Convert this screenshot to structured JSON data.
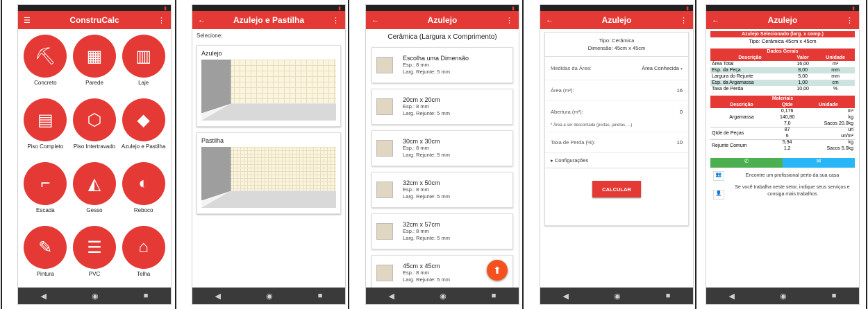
{
  "colors": {
    "primary": "#e53935",
    "fab": "#f4511e",
    "navbar": "#3a3a3a"
  },
  "home": {
    "title": "ConstruCalc",
    "items": [
      {
        "label": "Concreto",
        "icon": "wheelbarrow-icon",
        "glyph": "⛏"
      },
      {
        "label": "Parede",
        "icon": "brick-wall-icon",
        "glyph": "▦"
      },
      {
        "label": "Laje",
        "icon": "slab-icon",
        "glyph": "▥"
      },
      {
        "label": "Piso Completo",
        "icon": "floor-tiles-icon",
        "glyph": "▤"
      },
      {
        "label": "Piso Intertravado",
        "icon": "hexagon-icon",
        "glyph": "⬡"
      },
      {
        "label": "Azulejo e Pastilha",
        "icon": "diamond-tile-icon",
        "glyph": "◆"
      },
      {
        "label": "Escada",
        "icon": "stairs-icon",
        "glyph": "⌐"
      },
      {
        "label": "Gesso",
        "icon": "trowel-icon",
        "glyph": "◭"
      },
      {
        "label": "Reboco",
        "icon": "plaster-wall-icon",
        "glyph": "◐"
      },
      {
        "label": "Pintura",
        "icon": "paint-brush-icon",
        "glyph": "✎"
      },
      {
        "label": "PVC",
        "icon": "pvc-panels-icon",
        "glyph": "☰"
      },
      {
        "label": "Telha",
        "icon": "roof-tile-icon",
        "glyph": "⌂"
      }
    ]
  },
  "azulejo_pastilha": {
    "title": "Azulejo e Pastilha",
    "prompt": "Selecione:",
    "cards": [
      {
        "label": "Azulejo"
      },
      {
        "label": "Pastilha"
      }
    ]
  },
  "azulejo_list": {
    "title": "Azulejo",
    "heading": "Cerâmica (Largura x Comprimento)",
    "items": [
      {
        "size": "Escolha uma Dimensão",
        "esp": "Esp.: 8 mm",
        "rejunte": "Larg. Rejunte: 5 mm"
      },
      {
        "size": "20cm x 20cm",
        "esp": "Esp.: 8 mm",
        "rejunte": "Larg. Rejunte: 5 mm"
      },
      {
        "size": "30cm x 30cm",
        "esp": "Esp.: 8 mm",
        "rejunte": "Larg. Rejunte: 5 mm"
      },
      {
        "size": "32cm x 50cm",
        "esp": "Esp.: 8 mm",
        "rejunte": "Larg. Rejunte: 5 mm"
      },
      {
        "size": "32cm x 57cm",
        "esp": "Esp.: 8 mm",
        "rejunte": "Larg. Rejunte: 5 mm"
      },
      {
        "size": "45cm x 45cm",
        "esp": "Esp.: 8 mm",
        "rejunte": "Larg. Rejunte: 5 mm"
      }
    ]
  },
  "azulejo_form": {
    "title": "Azulejo",
    "tipo": "Tipo: Cerâmica",
    "dimensao": "Dimensão: 45cm x 45cm",
    "medidas_label": "Medidas da Área:",
    "medidas_value": "Área Conhecida",
    "area_label": "Área (m²):",
    "area_value": "16",
    "abertura_label": "Abertura (m²):",
    "abertura_value": "0",
    "note": "* Área a ser descontada (portas, janelas, ...)",
    "perda_label": "Taxa de Perda (%):",
    "perda_value": "10",
    "config": "▸ Configurações",
    "calc_button": "CALCULAR"
  },
  "result": {
    "title": "Azulejo",
    "selected_header": "Azulejo Selecionado (larg. x comp.)",
    "selected_value": "Tipo: Cerâmica 45cm x 45cm",
    "gerais_header": "Dados Gerais",
    "cols": [
      "Descrição",
      "Valor",
      "Unidade"
    ],
    "gerais_rows": [
      {
        "d": "Área Total",
        "v": "16,00",
        "u": "m²"
      },
      {
        "d": "Esp. da Peça",
        "v": "8,00",
        "u": "mm"
      },
      {
        "d": "Largura do Rejunte",
        "v": "5,00",
        "u": "mm"
      },
      {
        "d": "Esp. da Argamassa",
        "v": "1,00",
        "u": "cm"
      },
      {
        "d": "Taxa de Perda",
        "v": "10,00",
        "u": "%"
      }
    ],
    "materiais_header": "Materiais",
    "mat_cols": [
      "Descrição",
      "Qtde",
      "Unidade"
    ],
    "argamassa": {
      "label": "Argamassa",
      "q1": "0,176",
      "u1": "m³",
      "q2": "140,80",
      "u2": "kg",
      "q3": "7,0",
      "u3": "Sacos 20.0kg"
    },
    "pecas": {
      "label": "Qtde de Peças",
      "q1": "87",
      "u1": "un",
      "q2": "6",
      "u2": "un/m²"
    },
    "rejunte": {
      "label": "Rejunte Comum",
      "q1": "5,94",
      "u1": "kg",
      "q2": "1,2",
      "u2": "Sacos 5.0kg"
    },
    "promo1": "Encontre um profissional perto da sua casa",
    "promo2": "Se você trabalha neste setor, indique seus serviços e consiga mais trabalhos"
  }
}
